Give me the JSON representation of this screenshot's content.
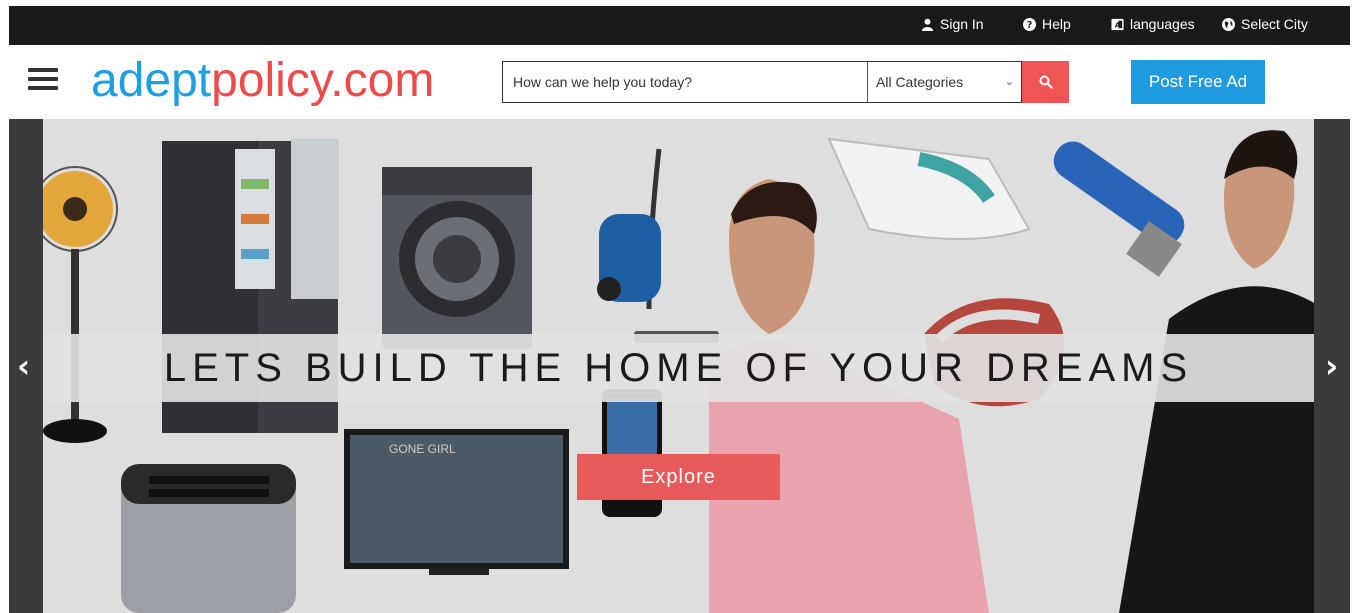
{
  "topbar": {
    "sign_in": "Sign In",
    "help": "Help",
    "languages": "languages",
    "select_city": "Select City"
  },
  "header": {
    "logo_part1": "adept",
    "logo_part2": "policy.com",
    "search_placeholder": "How can we help you today?",
    "category_selected": "All Categories",
    "post_ad": "Post Free Ad"
  },
  "hero": {
    "headline": "LETS BUILD THE HOME OF YOUR DREAMS",
    "explore": "Explore",
    "prev": "‹",
    "next": "›",
    "tv_title": "GONE GIRL"
  },
  "colors": {
    "brand_blue": "#1ca0e4",
    "brand_red": "#ef4a4a",
    "topbar_bg": "#1a1a1a",
    "post_button": "#1f9be0",
    "explore_button": "#e85a5a"
  }
}
